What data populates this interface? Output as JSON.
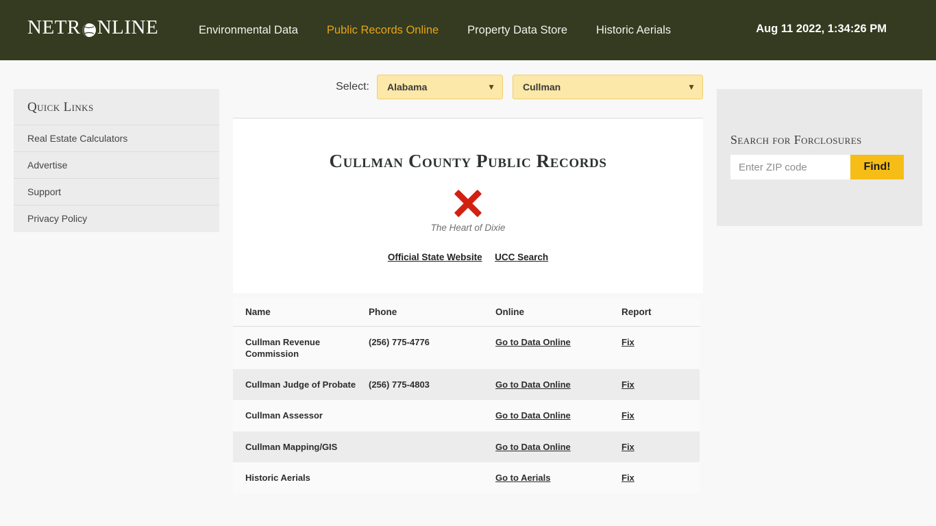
{
  "header": {
    "logo": {
      "prefix": "NETR",
      "icon": "globe-icon",
      "suffix": "NLINE"
    },
    "nav": [
      {
        "label": "Environmental Data",
        "active": false
      },
      {
        "label": "Public Records Online",
        "active": true
      },
      {
        "label": "Property Data Store",
        "active": false
      },
      {
        "label": "Historic Aerials",
        "active": false
      }
    ],
    "datetime": "Aug 11 2022, 1:34:26 PM",
    "background_color": "#343b20",
    "active_color": "#e8a317"
  },
  "sidebar": {
    "title": "Quick Links",
    "items": [
      {
        "label": "Real Estate Calculators"
      },
      {
        "label": "Advertise"
      },
      {
        "label": "Support"
      },
      {
        "label": "Privacy Policy"
      }
    ]
  },
  "selectors": {
    "label": "Select:",
    "state": {
      "value": "Alabama",
      "chevron": "chevron-down-icon"
    },
    "county": {
      "value": "Cullman",
      "chevron": "chevron-down-icon"
    }
  },
  "main": {
    "title": "Cullman County Public Records",
    "seal_alt_text": "The Heart of Dixie",
    "seal_icon": "broken-image-icon",
    "links": [
      {
        "label": "Official State Website"
      },
      {
        "label": "UCC Search"
      }
    ]
  },
  "table": {
    "columns": [
      "Name",
      "Phone",
      "Online",
      "Report"
    ],
    "rows": [
      {
        "name": "Cullman Revenue Commission",
        "phone": "(256) 775-4776",
        "online": "Go to Data Online",
        "report": "Fix"
      },
      {
        "name": "Cullman Judge of Probate",
        "phone": "(256) 775-4803",
        "online": "Go to Data Online",
        "report": "Fix"
      },
      {
        "name": "Cullman Assessor",
        "phone": "",
        "online": "Go to Data Online",
        "report": "Fix"
      },
      {
        "name": "Cullman Mapping/GIS",
        "phone": "",
        "online": "Go to Data Online",
        "report": "Fix"
      },
      {
        "name": "Historic Aerials",
        "phone": "",
        "online": "Go to Aerials",
        "report": "Fix"
      }
    ]
  },
  "foreclosure_search": {
    "title": "Search for Forclosures",
    "placeholder": "Enter ZIP code",
    "value": "",
    "button_label": "Find!",
    "button_color": "#f5bd16"
  }
}
